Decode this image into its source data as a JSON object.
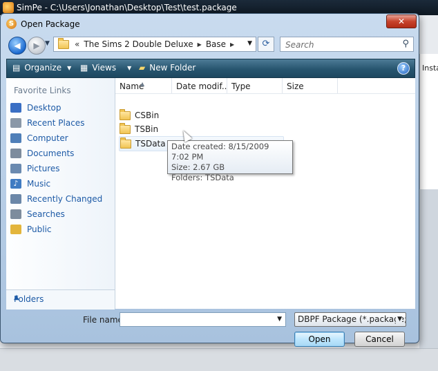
{
  "app": {
    "title": "SimPe - C:\\Users\\Jonathan\\Desktop\\Test\\test.package",
    "right_panel_text": "Insta"
  },
  "dialog": {
    "title": "Open Package",
    "close_label": "✕"
  },
  "address": {
    "overflow": "«",
    "crumbs": [
      "The Sims 2 Double Deluxe",
      "Base"
    ]
  },
  "search": {
    "placeholder": "Search"
  },
  "toolbar": {
    "organize_label": "Organize",
    "views_label": "Views",
    "new_folder_label": "New Folder",
    "help_label": "?"
  },
  "nav": {
    "favorite_links_header": "Favorite Links",
    "items": [
      {
        "label": "Desktop",
        "icon": "desktop-icon",
        "color": "#3a6fc4"
      },
      {
        "label": "Recent Places",
        "icon": "recent-places-icon",
        "color": "#8a98a8"
      },
      {
        "label": "Computer",
        "icon": "computer-icon",
        "color": "#4f7fb8"
      },
      {
        "label": "Documents",
        "icon": "documents-icon",
        "color": "#7d8c9d"
      },
      {
        "label": "Pictures",
        "icon": "pictures-icon",
        "color": "#6a8ab0"
      },
      {
        "label": "Music",
        "icon": "music-icon",
        "color": "#3f7bc2"
      },
      {
        "label": "Recently Changed",
        "icon": "recently-changed-icon",
        "color": "#6b87a8"
      },
      {
        "label": "Searches",
        "icon": "searches-icon",
        "color": "#7d8c9d"
      },
      {
        "label": "Public",
        "icon": "public-icon",
        "color": "#e3b53c"
      }
    ],
    "folders_label": "Folders"
  },
  "file_list": {
    "columns": [
      "Name",
      "Date modif...",
      "Type",
      "Size"
    ],
    "rows": [
      {
        "name": "CSBin"
      },
      {
        "name": "TSBin"
      },
      {
        "name": "TSData"
      }
    ],
    "tooltip": {
      "date_created": "Date created: 8/15/2009 7:02 PM",
      "size": "Size: 2.67 GB",
      "folders": "Folders: TSData"
    }
  },
  "bottom": {
    "filename_label": "File name:",
    "filename_value": "",
    "filetype_value": "DBPF Package (*.package;*.",
    "open_label": "Open",
    "cancel_label": "Cancel"
  },
  "colors": {
    "toolbar": "#27556f",
    "link": "#1d5aa6",
    "close": "#c7432c"
  }
}
